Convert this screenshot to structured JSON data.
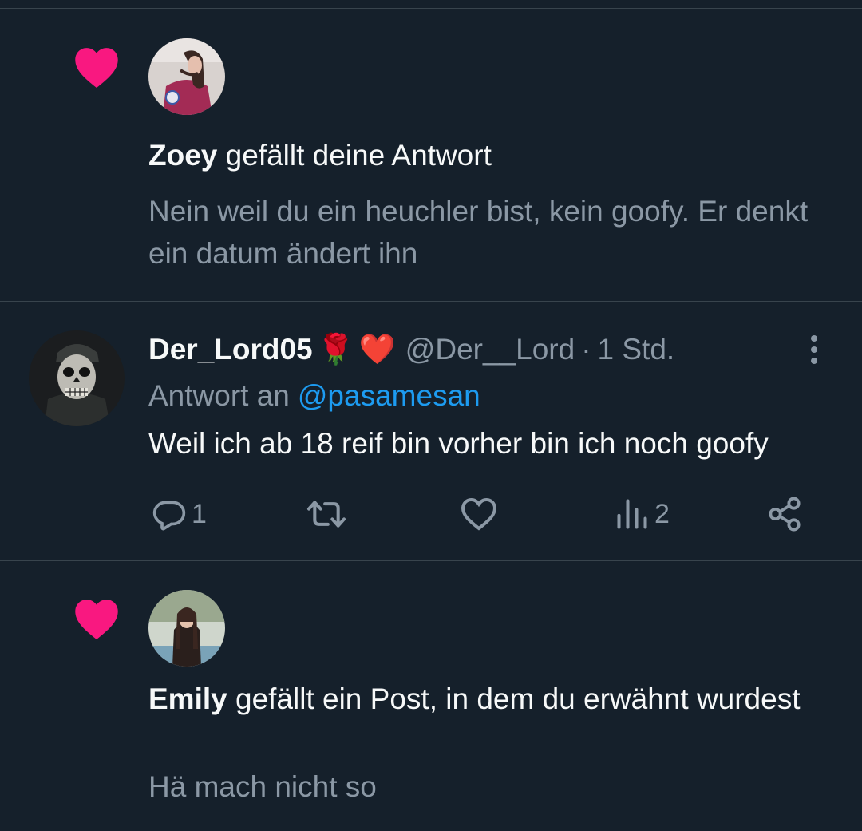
{
  "colors": {
    "background": "#15202b",
    "divider": "#38444d",
    "heart": "#f91880",
    "text_primary": "#f7f9f9",
    "text_secondary": "#8b98a5",
    "link": "#1d9bf0"
  },
  "notifications": [
    {
      "icon": "heart-icon",
      "name": "Zoey",
      "action_text": " gefällt deine Antwort",
      "snippet": "Nein weil du ein heuchler bist, kein goofy. Er denkt ein datum ändert ihn"
    },
    {
      "icon": "heart-icon",
      "name": "Emily",
      "action_text": " gefällt ein Post, in dem du erwähnt wurdest",
      "snippet": "Hä mach nicht so"
    }
  ],
  "reply_tweet": {
    "display_name": "Der_Lord05",
    "emojis": [
      "🌹",
      "❤️"
    ],
    "handle": "@Der__Lord",
    "separator": "·",
    "time": "1 Std.",
    "reply_prefix": "Antwort an",
    "reply_to": "@pasamesan",
    "text": "Weil ich ab 18 reif bin vorher bin ich noch goofy",
    "actions": {
      "reply": {
        "icon": "reply-icon",
        "count": "1"
      },
      "retweet": {
        "icon": "retweet-icon",
        "count": ""
      },
      "like": {
        "icon": "like-icon",
        "count": ""
      },
      "views": {
        "icon": "views-icon",
        "count": "2"
      },
      "share": {
        "icon": "share-icon"
      }
    },
    "menu_icon": "more-options-icon"
  }
}
